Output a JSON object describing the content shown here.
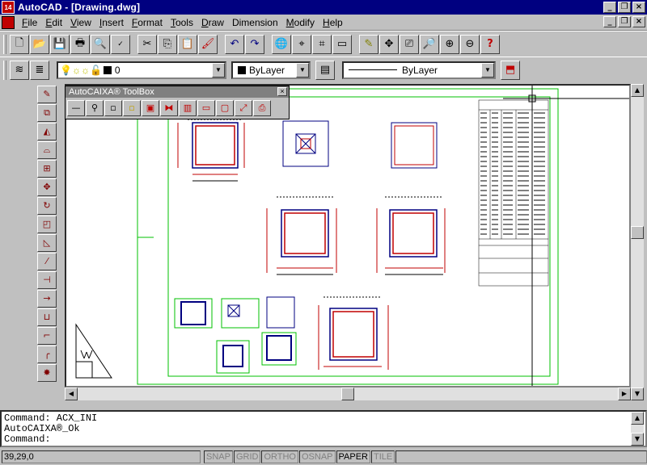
{
  "window": {
    "app_icon_text": "14",
    "title": "AutoCAD - [Drawing.dwg]",
    "minimize": "_",
    "maximize": "❐",
    "close": "×"
  },
  "menu": {
    "items": [
      {
        "key": "F",
        "rest": "ile"
      },
      {
        "key": "E",
        "rest": "dit"
      },
      {
        "key": "V",
        "rest": "iew"
      },
      {
        "key": "I",
        "rest": "nsert"
      },
      {
        "key": "F",
        "rest": "ormat"
      },
      {
        "key": "T",
        "rest": "ools"
      },
      {
        "key": "D",
        "rest": "raw"
      },
      {
        "key": "",
        "rest": "Dimension"
      },
      {
        "key": "M",
        "rest": "odify"
      },
      {
        "key": "H",
        "rest": "elp"
      }
    ]
  },
  "standard_toolbar": {
    "icons": [
      "new-icon",
      "open-icon",
      "save-icon",
      "print-icon",
      "preview-icon",
      "spell-icon",
      "cut-icon",
      "copy-icon",
      "paste-icon",
      "matchprop-icon",
      "undo-icon",
      "redo-icon",
      "hyperlink-icon",
      "snap-icon",
      "tracking-icon",
      "redraw-icon",
      "pen-icon",
      "pan-icon",
      "ucs-icon",
      "zoom-realtime-icon",
      "zoom-window-icon",
      "zoom-previous-icon",
      "help-icon"
    ]
  },
  "properties_toolbar": {
    "layer_value": "0",
    "color_value": "ByLayer",
    "linetype_value": "ByLayer"
  },
  "toolbox": {
    "title": "AutoCAIXA® ToolBox",
    "close": "×"
  },
  "command": {
    "lines": [
      "Command: ACX_INI",
      "AutoCAIXA®_Ok"
    ],
    "prompt": "Command:"
  },
  "status": {
    "coords": "39,29,0",
    "modes": [
      {
        "label": "SNAP",
        "on": false
      },
      {
        "label": "GRID",
        "on": false
      },
      {
        "label": "ORTHO",
        "on": false
      },
      {
        "label": "OSNAP",
        "on": false
      },
      {
        "label": "PAPER",
        "on": true
      },
      {
        "label": "TILE",
        "on": false
      }
    ]
  },
  "colors": {
    "titlebar": "#000080",
    "face": "#c0c0c0",
    "drawing_bg": "#ffffff",
    "sheet_border": "#00c000",
    "section_outline": "#000080",
    "rebar": "#c00000"
  }
}
